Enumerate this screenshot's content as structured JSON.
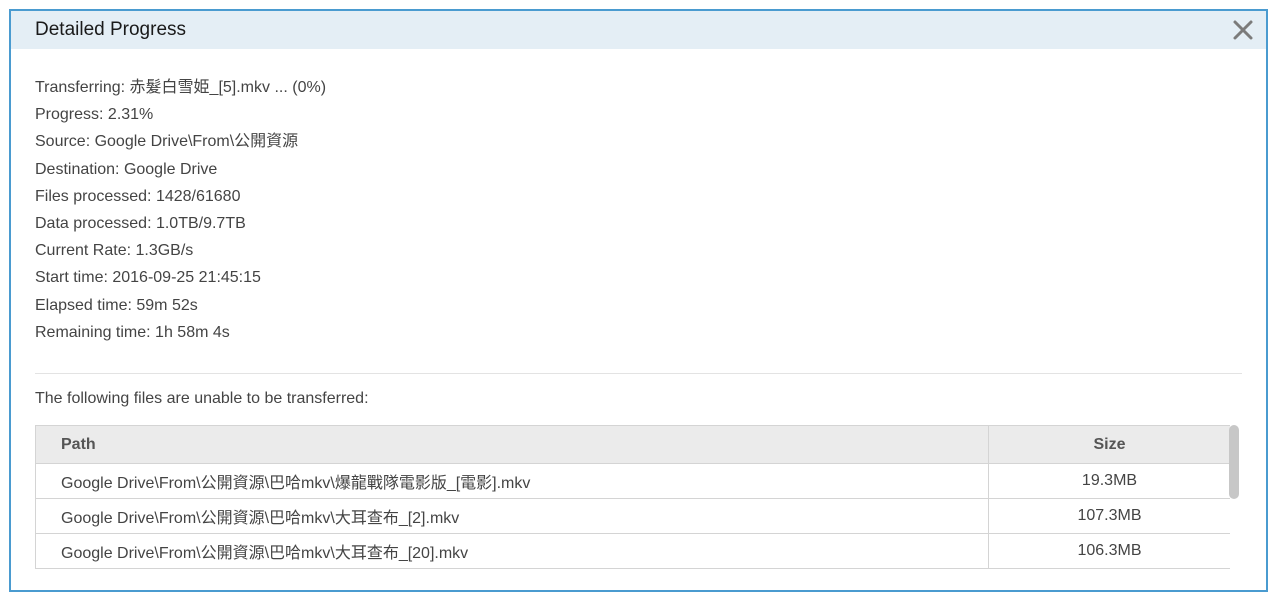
{
  "dialog": {
    "title": "Detailed Progress",
    "close_icon": "close-icon"
  },
  "info": {
    "transferring": "Transferring: 赤髮白雪姫_[5].mkv ... (0%)",
    "progress": "Progress: 2.31%",
    "source": "Source: Google Drive\\From\\公開資源",
    "destination": "Destination: Google Drive",
    "files_processed": "Files processed: 1428/61680",
    "data_processed": "Data processed: 1.0TB/9.7TB",
    "current_rate": "Current Rate: 1.3GB/s",
    "start_time": "Start time: 2016-09-25 21:45:15",
    "elapsed_time": "Elapsed time: 59m 52s",
    "remaining_time": "Remaining time: 1h 58m 4s"
  },
  "failed": {
    "label": "The following files are unable to be transferred:",
    "columns": {
      "path": "Path",
      "size": "Size"
    },
    "rows": [
      {
        "path": "Google Drive\\From\\公開資源\\巴哈mkv\\爆龍戰隊電影版_[電影].mkv",
        "size": "19.3MB"
      },
      {
        "path": "Google Drive\\From\\公開資源\\巴哈mkv\\大耳查布_[2].mkv",
        "size": "107.3MB"
      },
      {
        "path": "Google Drive\\From\\公開資源\\巴哈mkv\\大耳查布_[20].mkv",
        "size": "106.3MB"
      }
    ]
  }
}
